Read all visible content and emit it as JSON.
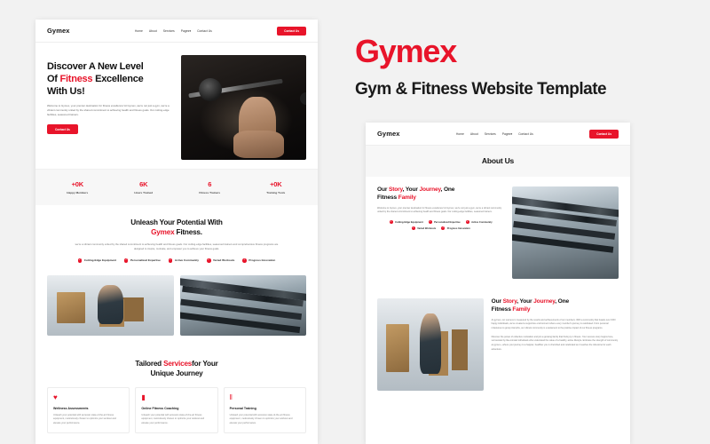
{
  "brand": {
    "name": "Gymex",
    "subtitle": "Gym & Fitness Website Template",
    "accent_color": "#e8142a",
    "text_color": "#1a1a1a",
    "page_background": "#f2f2f2"
  },
  "nav": {
    "logo": "Gymex",
    "links": [
      {
        "label": "Home"
      },
      {
        "label": "About"
      },
      {
        "label": "Services"
      },
      {
        "label": "Pages",
        "caret": "▾"
      },
      {
        "label": "Contact Us"
      }
    ],
    "cta_label": "Contact Us"
  },
  "home_page": {
    "hero": {
      "heading_1": "Discover A New Level",
      "heading_2_pre": "Of ",
      "heading_2_accent": "Fitness",
      "heading_2_post": " Excellence",
      "heading_3": "With Us!",
      "paragraph": "Welcome to Gymex, your premier destination for fitness excellence! At Gymex, we're not just a gym, we're a vibrant community united by the shared commitment to achieving health and fitness goals. Our cutting-edge facilities, seasoned trainers.",
      "cta_label": "Contact Us",
      "image_name": "barbell-squat-photo"
    },
    "stats": [
      {
        "value": "+0K",
        "label": "Happy Members"
      },
      {
        "value": "6K",
        "label": "Hours Trained"
      },
      {
        "value": "6",
        "label": "Fitness Trainers"
      },
      {
        "value": "+0K",
        "label": "Training Tools"
      }
    ],
    "potential": {
      "heading_line1": "Unleash Your Potential With",
      "heading_accent": "Gymex",
      "heading_line2_post": " Fitness.",
      "paragraph": "we're a vibrant community united by the shared commitment to achieving health and fitness goals. Our cutting-edge facilities, seasoned trainers and comprehensive fitness programs are designed to inspire, motivate, and empower you to achieve your fitness goals.",
      "features": [
        "Cutting-Edge Equipment",
        "Personalized Expertise",
        "Active Community",
        "Varied Workouts",
        "Progress Innovation"
      ],
      "check_glyph": "✓"
    },
    "gallery": [
      {
        "name": "man-on-bench-photo"
      },
      {
        "name": "dumbbell-rack-photo"
      }
    ],
    "services": {
      "heading_pre": "Tailored ",
      "heading_accent": "Services",
      "heading_post": "for Your",
      "heading_line2": "Unique Journey",
      "cards": [
        {
          "icon": "heart-icon",
          "glyph": "♥",
          "title": "Wellness Assessments",
          "text": "Unleash your potential with accessto state-of-the-art fitness equipment, meticulously chosen to optimize your workout and elevate your performance."
        },
        {
          "icon": "book-icon",
          "glyph": "▮",
          "title": "Online Fitness Coaching",
          "text": "Unleash your potential with accessto state-of-the-art fitness equipment, meticulously chosen to optimize your workout and elevate your performance."
        },
        {
          "icon": "dumbbell-icon",
          "glyph": "‖",
          "title": "Personal Training",
          "text": "Unleash your potential with accessto state-of-the-art fitness equipment, meticulously chosen to optimize your workout and elevate your performance."
        }
      ]
    }
  },
  "about_page": {
    "title": "About Us",
    "blocks": [
      {
        "heading_pre": "Our ",
        "heading_accent_1": "Story",
        "heading_mid": ", Your ",
        "heading_accent_2": "Journey",
        "heading_post": ", One",
        "heading_line2_pre": "Fitness ",
        "heading_accent_3": "Family",
        "paragraph": "Welcome to Gymex, your premier destination for fitness excellence! At Gymex, we're not just a gym, we're a vibrant community united by the shared commitment to achieving health and fitness goals. Our cutting-edge facilities, seasoned trainers.",
        "features": [
          "Cutting-Edge Equipment",
          "Personalized Expertise",
          "Active Community",
          "Varied Workouts",
          "Progress Innovation"
        ],
        "image_name": "dumbbell-rack-photo"
      },
      {
        "heading_pre": "Our ",
        "heading_accent_1": "Story",
        "heading_mid": ", Your ",
        "heading_accent_2": "Journey",
        "heading_post": ", One",
        "heading_line2_pre": "Fitness ",
        "heading_accent_3": "Family",
        "paragraph": "At gymex, our success is measured by the results and achievements of our members. With a community that boasts over 0OO happy individuals, we've created a supportive environment where every member's journey is celebrated. From personal milestones to group triumphs, our vibrant community is a testament to the positive impact of our fitness programs.",
        "paragraph_2": "Discover the power of collective motivation and join a growing family that finds joy in fitness. Your success story begins here, surrounded by like-minded individuals who understand the value of a healthy, active lifestyle. Embrace the strength of community at gymex—where your journey to a happier, healthier you is cherished and celebrated as it reaches the milestone for each adventure.",
        "image_name": "man-on-bench-photo"
      }
    ]
  }
}
